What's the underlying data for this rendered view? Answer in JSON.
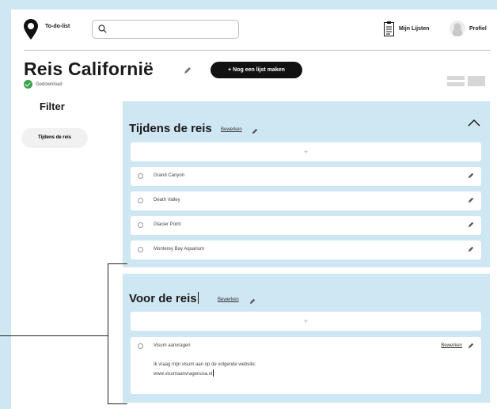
{
  "header": {
    "app_name": "To-do-list",
    "search_placeholder": "",
    "lists_label": "Mijn Lijsten",
    "profile_label": "Profiel"
  },
  "page": {
    "title": "Reis Californië",
    "create_button": "+ Nog een lijst maken",
    "status": "Gedownload"
  },
  "filter": {
    "title": "Filter",
    "chips": [
      "Tijdens de reis"
    ]
  },
  "sections": [
    {
      "title": "Tijdens de reis",
      "edit_label": "Bewerken",
      "add_symbol": "+",
      "items": [
        "Grand Canyon",
        "Death Valley",
        "Glacier Point",
        "Monterey Bay Aquarium"
      ]
    },
    {
      "title": "Voor de reis",
      "edit_label": "Bewerken",
      "add_symbol": "+",
      "items": [
        {
          "label": "Visum aanvragen",
          "edit_label": "Bewerken",
          "note_line1": "Ik vraag mijn visum aan op de volgende website:",
          "note_line2": "www.visumaanvragenusa.nl"
        }
      ]
    }
  ]
}
